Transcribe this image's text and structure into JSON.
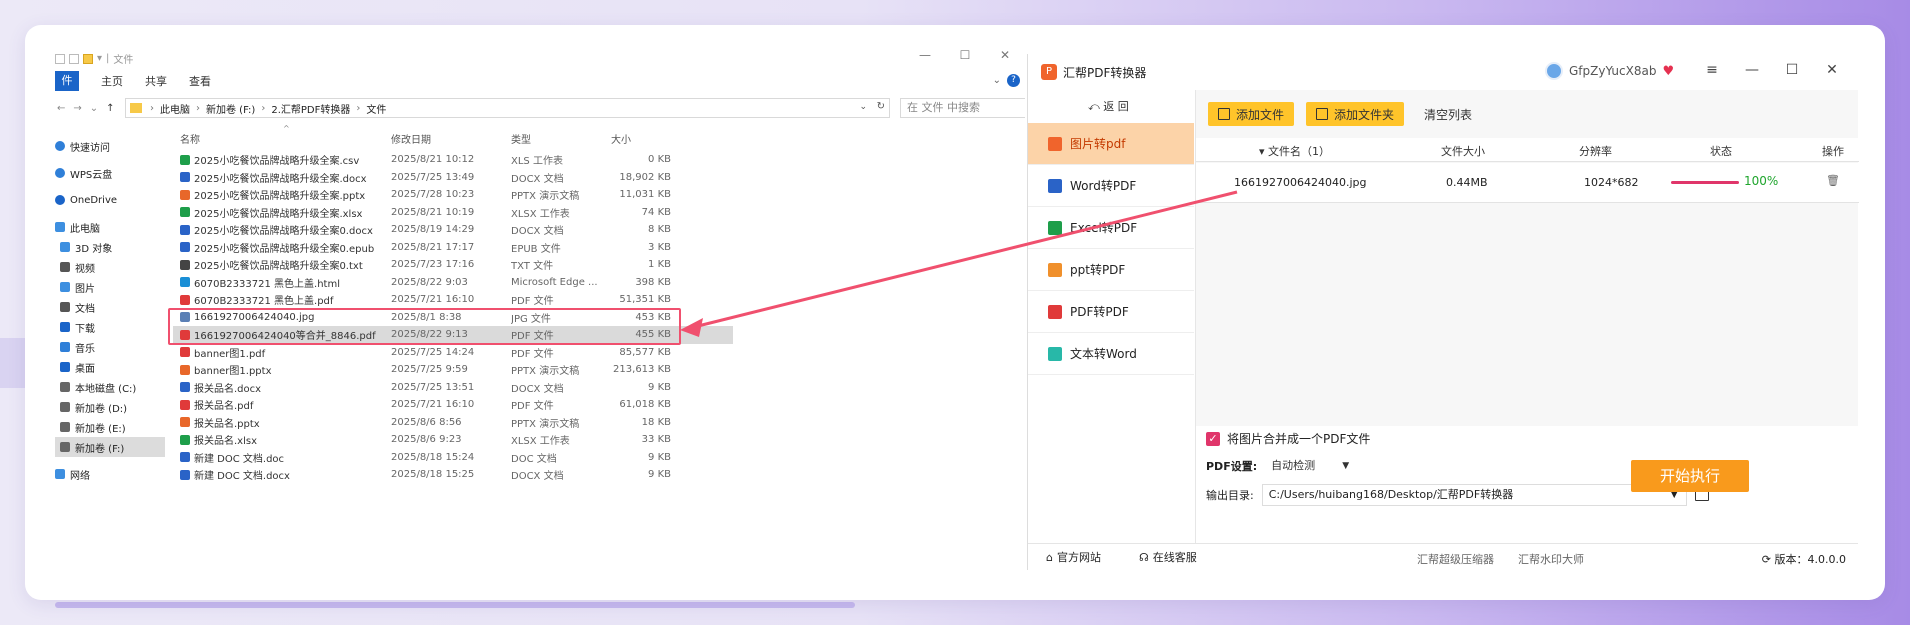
{
  "explorer": {
    "title": "文件",
    "ribbon": {
      "file": "件",
      "tabs": [
        "主页",
        "共享",
        "查看"
      ]
    },
    "address": {
      "crumbs": [
        "此电脑",
        "新加卷 (F:)",
        "2.汇帮PDF转换器",
        "文件"
      ]
    },
    "search_placeholder": "在 文件 中搜索",
    "nav": {
      "quick": "快速访问",
      "wps": "WPS云盘",
      "onedrive": "OneDrive",
      "pc": "此电脑",
      "sub": [
        "3D 对象",
        "视频",
        "图片",
        "文档",
        "下载",
        "音乐",
        "桌面",
        "本地磁盘 (C:)",
        "新加卷 (D:)",
        "新加卷 (E:)",
        "新加卷 (F:)"
      ],
      "network": "网络"
    },
    "headers": {
      "name": "名称",
      "date": "修改日期",
      "type": "类型",
      "size": "大小"
    },
    "files": [
      {
        "name": "2025小吃餐饮品牌战略升级全案.csv",
        "date": "2025/8/21 10:12",
        "type": "XLS 工作表",
        "size": "0 KB",
        "color": "#1e9e4a"
      },
      {
        "name": "2025小吃餐饮品牌战略升级全案.docx",
        "date": "2025/7/25 13:49",
        "type": "DOCX 文档",
        "size": "18,902 KB",
        "color": "#2a63c7"
      },
      {
        "name": "2025小吃餐饮品牌战略升级全案.pptx",
        "date": "2025/7/28 10:23",
        "type": "PPTX 演示文稿",
        "size": "11,031 KB",
        "color": "#e8672a"
      },
      {
        "name": "2025小吃餐饮品牌战略升级全案.xlsx",
        "date": "2025/8/21 10:19",
        "type": "XLSX 工作表",
        "size": "74 KB",
        "color": "#1e9e4a"
      },
      {
        "name": "2025小吃餐饮品牌战略升级全案0.docx",
        "date": "2025/8/19 14:29",
        "type": "DOCX 文档",
        "size": "8 KB",
        "color": "#2a63c7"
      },
      {
        "name": "2025小吃餐饮品牌战略升级全案0.epub",
        "date": "2025/8/21 17:17",
        "type": "EPUB 文件",
        "size": "3 KB",
        "color": "#2a63c7"
      },
      {
        "name": "2025小吃餐饮品牌战略升级全案0.txt",
        "date": "2025/7/23 17:16",
        "type": "TXT 文件",
        "size": "1 KB",
        "color": "#444444"
      },
      {
        "name": "6070B2333721 黑色上盖.html",
        "date": "2025/8/22 9:03",
        "type": "Microsoft Edge ...",
        "size": "398 KB",
        "color": "#1a8fd6"
      },
      {
        "name": "6070B2333721 黑色上盖.pdf",
        "date": "2025/7/21 16:10",
        "type": "PDF 文件",
        "size": "51,351 KB",
        "color": "#e03a3a"
      },
      {
        "name": "1661927006424040.jpg",
        "date": "2025/8/1 8:38",
        "type": "JPG 文件",
        "size": "453 KB",
        "color": "#5a7fb5"
      },
      {
        "name": "1661927006424040等合并_8846.pdf",
        "date": "2025/8/22 9:13",
        "type": "PDF 文件",
        "size": "455 KB",
        "color": "#e03a3a"
      },
      {
        "name": "banner图1.pdf",
        "date": "2025/7/25 14:24",
        "type": "PDF 文件",
        "size": "85,577 KB",
        "color": "#e03a3a"
      },
      {
        "name": "banner图1.pptx",
        "date": "2025/7/25 9:59",
        "type": "PPTX 演示文稿",
        "size": "213,613 KB",
        "color": "#e8672a"
      },
      {
        "name": "报关品名.docx",
        "date": "2025/7/25 13:51",
        "type": "DOCX 文档",
        "size": "9 KB",
        "color": "#2a63c7"
      },
      {
        "name": "报关品名.pdf",
        "date": "2025/7/21 16:10",
        "type": "PDF 文件",
        "size": "61,018 KB",
        "color": "#e03a3a"
      },
      {
        "name": "报关品名.pptx",
        "date": "2025/8/6 8:56",
        "type": "PPTX 演示文稿",
        "size": "18 KB",
        "color": "#e8672a"
      },
      {
        "name": "报关品名.xlsx",
        "date": "2025/8/6 9:23",
        "type": "XLSX 工作表",
        "size": "33 KB",
        "color": "#1e9e4a"
      },
      {
        "name": "新建 DOC 文档.doc",
        "date": "2025/8/18 15:24",
        "type": "DOC 文档",
        "size": "9 KB",
        "color": "#2a63c7"
      },
      {
        "name": "新建 DOC 文档.docx",
        "date": "2025/8/18 15:25",
        "type": "DOCX 文档",
        "size": "9 KB",
        "color": "#2a63c7"
      }
    ]
  },
  "app": {
    "name": "汇帮PDF转换器",
    "user": "GfpZyYucX8ab",
    "back": "返 回",
    "sidebar": [
      {
        "label": "图片转pdf",
        "color": "#f0642c"
      },
      {
        "label": "Word转PDF",
        "color": "#2a63c7"
      },
      {
        "label": "Excel转PDF",
        "color": "#1e9e4a"
      },
      {
        "label": "ppt转PDF",
        "color": "#f0902c"
      },
      {
        "label": "PDF转PDF",
        "color": "#e03a3a"
      },
      {
        "label": "文本转Word",
        "color": "#28b8a8"
      }
    ],
    "toolbar": {
      "add_file": "添加文件",
      "add_folder": "添加文件夹",
      "clear": "清空列表"
    },
    "table_headers": {
      "name": "▾ 文件名（1）",
      "size": "文件大小",
      "res": "分辨率",
      "status": "状态",
      "op": "操作"
    },
    "row": {
      "name": "1661927006424040.jpg",
      "size": "0.44MB",
      "res": "1024*682",
      "pct": "100%",
      "progress": 1.0
    },
    "merge_label": "将图片合并成一个PDF文件",
    "pdf_setting_label": "PDF设置:",
    "pdf_setting_value": "自动检测",
    "output_label": "输出目录:",
    "output_path": "C:/Users/huibang168/Desktop/汇帮PDF转换器",
    "start": "开始执行",
    "footer": {
      "site": "官方网站",
      "service": "在线客服",
      "compress": "汇帮超级压缩器",
      "watermark": "汇帮水印大师",
      "version": "版本：4.0.0.0"
    }
  }
}
